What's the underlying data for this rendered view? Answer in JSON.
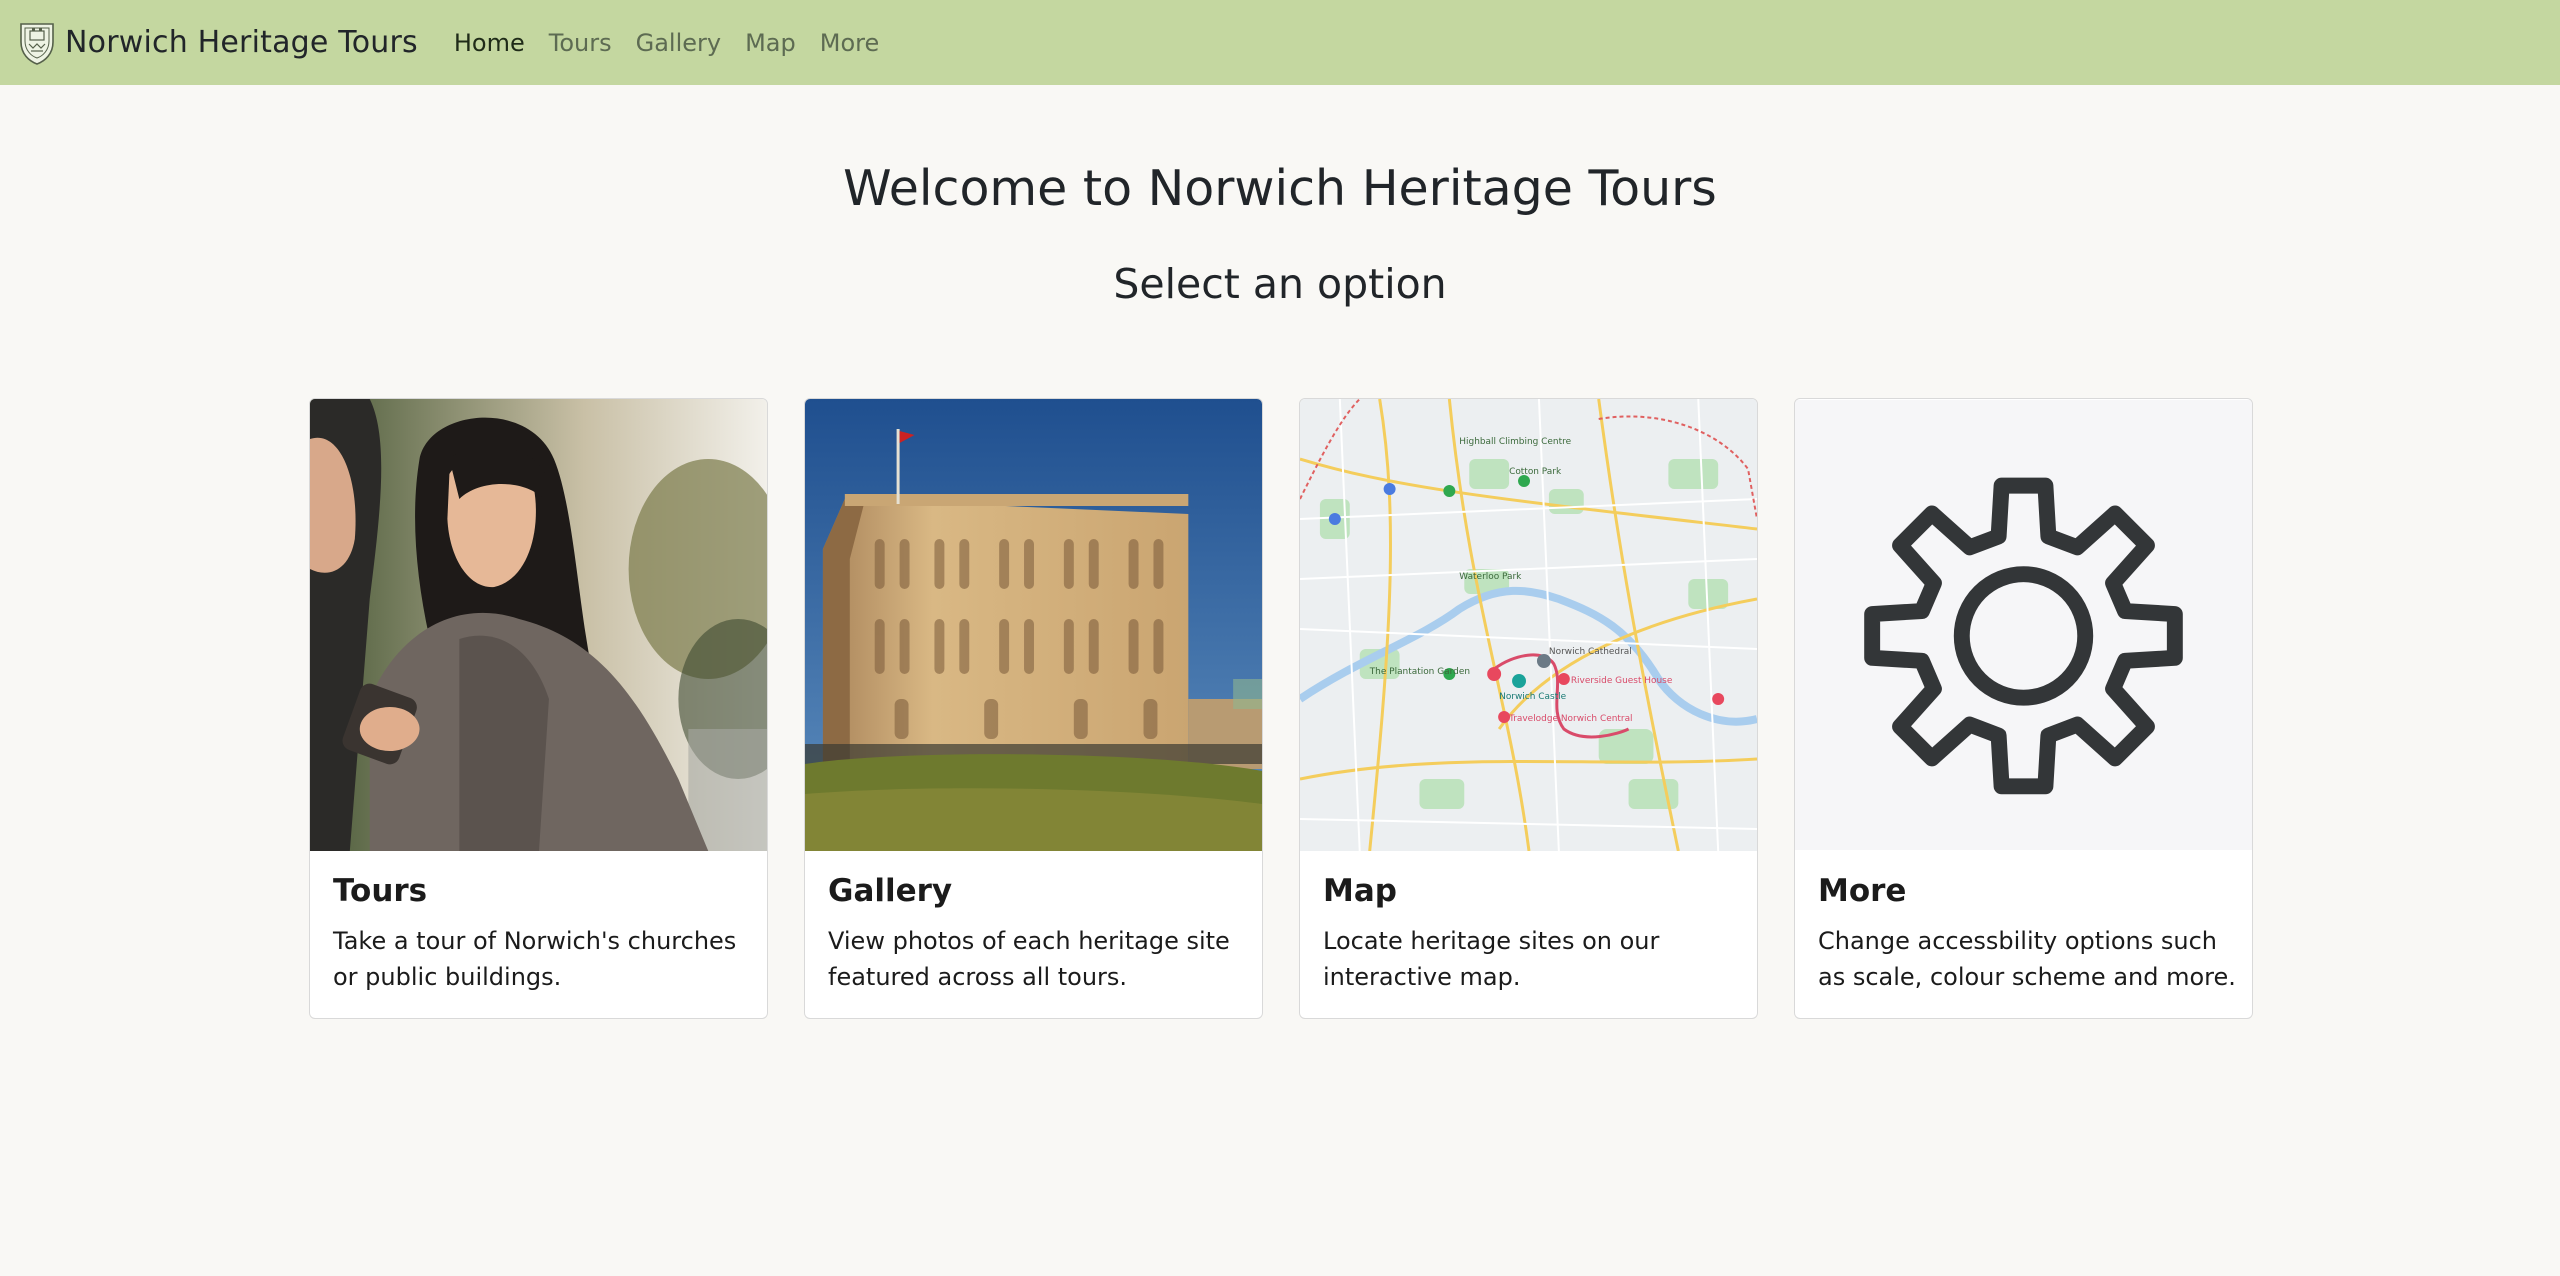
{
  "navbar": {
    "brand": "Norwich Heritage Tours",
    "links": [
      {
        "label": "Home",
        "active": true
      },
      {
        "label": "Tours",
        "active": false
      },
      {
        "label": "Gallery",
        "active": false
      },
      {
        "label": "Map",
        "active": false
      },
      {
        "label": "More",
        "active": false
      }
    ]
  },
  "main": {
    "title": "Welcome to Norwich Heritage Tours",
    "subtitle": "Select an option"
  },
  "cards": [
    {
      "title": "Tours",
      "text": "Take a tour of Norwich's churches or public buildings.",
      "image": "people-with-phone-photo"
    },
    {
      "title": "Gallery",
      "text": "View photos of each heritage site featured across all tours.",
      "image": "norwich-castle-photo"
    },
    {
      "title": "Map",
      "text": "Locate heritage sites on our interactive map.",
      "image": "city-map-image"
    },
    {
      "title": "More",
      "text": "Change accessbility options such as scale, colour scheme and more.",
      "image": "gear-icon"
    }
  ],
  "map_labels": {
    "castle": "Norwich Castle",
    "cathedral": "Norwich Cathedral",
    "garden": "The Plantation Garden",
    "park": "Waterloo Park",
    "cotton": "Cotton Park"
  },
  "colors": {
    "navbar": "#c4d7a0",
    "page_background": "#f9f8f5",
    "nav_link": "#5d6b52",
    "nav_link_active": "#1f2b18",
    "text": "#212529"
  }
}
